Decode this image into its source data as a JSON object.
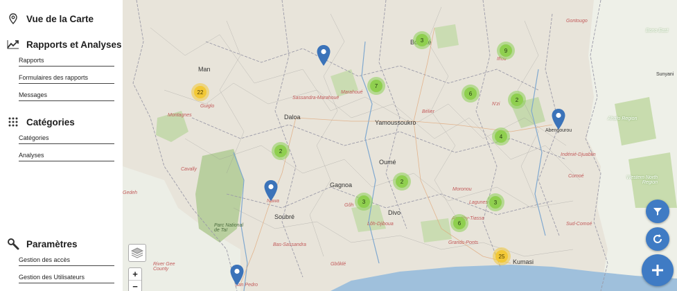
{
  "sidebar": {
    "map_view": {
      "title": "Vue de la Carte",
      "icon": "location-pin-icon"
    },
    "reports": {
      "title": "Rapports et Analyses",
      "icon": "trending-up-icon",
      "links": [
        "Rapports",
        "Formulaires des rapports",
        "Messages"
      ]
    },
    "categories": {
      "title": "Catégories",
      "icon": "grid-dots-icon",
      "links": [
        "Catégories",
        "Analyses"
      ]
    },
    "settings": {
      "title": "Paramètres",
      "icon": "wrench-search-icon",
      "links": [
        "Gestion des accès",
        "Gestion des Utilisateurs"
      ]
    }
  },
  "map": {
    "places": {
      "man": "Man",
      "guiglo": "Guiglo",
      "montagnes": "Montagnes",
      "daloa": "Daloa",
      "yamoussoukro": "Yamoussoukro",
      "bouake": "Bouaké",
      "sassandra": "Sassandra-Marahoué",
      "marahoue": "Marahoué",
      "oume": "Oumé",
      "gagnoa": "Gagnoa",
      "divo": "Divo",
      "soubre": "Soubré",
      "nawa": "Nawa",
      "parc": "Parc National de Taï",
      "bas_sassandra": "Bas-Sassandra",
      "san_pedro": "San Pedro",
      "abengourou": "Abengourou",
      "ahafo": "Ahafo Region",
      "western_north": "Western North Region",
      "bono_east": "Bono East",
      "sunyani": "Sunyani",
      "kumasi": "Kumasi",
      "grand_ponts": "Grands-Ponts",
      "lagunes": "Lagunes",
      "sud_comoe": "Sud-Comoé",
      "comoe": "Comoé",
      "gontougo": "Gontougo",
      "iffou": "Iffou",
      "nzi": "N'zi",
      "river_gee": "River Gee County",
      "gedeh": "Gedeh",
      "cavally": "Cavally",
      "loh_djiboua": "Lôh-Djiboua",
      "goh": "Gôh",
      "agneby": "Agnéby-Tiassa",
      "indenie": "Indénié-Djuablin",
      "moronou": "Moronou",
      "gbokle": "Gbôklé",
      "belier": "Bélier"
    },
    "clusters": [
      3,
      9,
      22,
      7,
      6,
      2,
      4,
      2,
      2,
      3,
      3,
      6,
      25
    ],
    "cluster_colors": {
      "small": "#8fcf4f",
      "large": "#f2c836"
    },
    "marker_color": "#3b73b9",
    "zoom_in": "+",
    "zoom_out": "−",
    "controls": [
      "filter-icon",
      "refresh-icon",
      "plus-icon"
    ],
    "accent": "#3f7bc4"
  }
}
